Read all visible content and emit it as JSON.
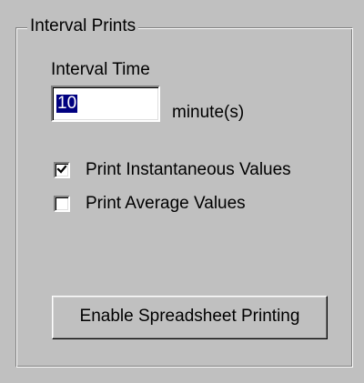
{
  "group": {
    "title": "Interval Prints"
  },
  "interval": {
    "label": "Interval Time",
    "value": "10",
    "unit": "minute(s)"
  },
  "options": [
    {
      "label": "Print Instantaneous Values",
      "checked": true
    },
    {
      "label": "Print Average Values",
      "checked": false
    }
  ],
  "actions": {
    "spreadsheet_label": "Enable Spreadsheet Printing"
  }
}
